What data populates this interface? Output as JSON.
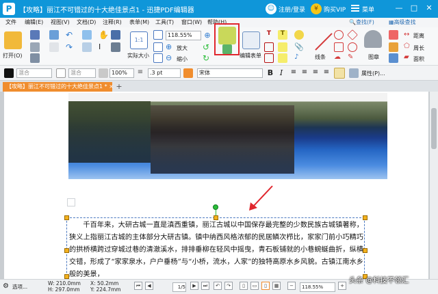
{
  "title": {
    "window_title": "【攻略】丽江不可错过的十大绝佳景点1 - 迅捷PDF编辑器",
    "login": "注册/登录",
    "vip": "购买VIP",
    "menu": "菜单",
    "minimize": "—",
    "maximize": "□",
    "close": "✕"
  },
  "menubar": {
    "items": [
      "文件",
      "编辑(E)",
      "视图(V)",
      "文档(D)",
      "注释(R)",
      "表单(M)",
      "工具(T)",
      "窗口(W)",
      "帮助(H)"
    ],
    "search": "查找(F)",
    "advanced_search": "高级查找"
  },
  "toolbar": {
    "open": "打开(O)",
    "actual_size": "实际大小",
    "zoom": "118.55%",
    "zoom_in": "放大",
    "zoom_out": "缩小",
    "edit_form": "编辑表单",
    "lines": "线条",
    "stamp": "图章",
    "distance": "距离",
    "perimeter": "周长",
    "area": "面积"
  },
  "formatbar": {
    "blend1": "混合",
    "blend2": "混合",
    "opacity": "100%",
    "line_width": ".3 pt",
    "font": "宋体",
    "properties": "属性(P)..."
  },
  "tab": {
    "label": "【攻略】丽江不可错过的十大绝佳景点1 *",
    "close": "×",
    "add": "+"
  },
  "document": {
    "paragraph": "千百年来，大研古城一直是滇西重镇，丽江古城以中国保存最完整的少数民族古城镇著称，狭义上指丽江古城的主体部分大研古镇。镇中纳西风格浓郁的民居鳞次栉比，家家门前小巧精巧的拱桥横跨过穿城过巷的清澈溪水，排排垂柳在轻风中摇曳，青石板铺就的小巷蜿蜒曲折，纵横交错，形成了“家家泉水，户户垂杨”与“小桥，流水，人家”的独特高原水乡风貌。古镇江南水乡般的美景，"
  },
  "status": {
    "options": "选项...",
    "width": "W: 210.0mm",
    "height": "H: 297.0mm",
    "x": "X: 50.2mm",
    "y": "Y: 224.7mm",
    "page": "1/5",
    "zoom": "118.55%"
  },
  "watermark": "头条 @科技不领汇",
  "colors": {
    "titlebar": "#0f96d9",
    "tab_active": "#f08d2e",
    "highlight": "#e0262d",
    "handle": "#f3b11f",
    "rotate_handle": "#2bbd3a"
  }
}
